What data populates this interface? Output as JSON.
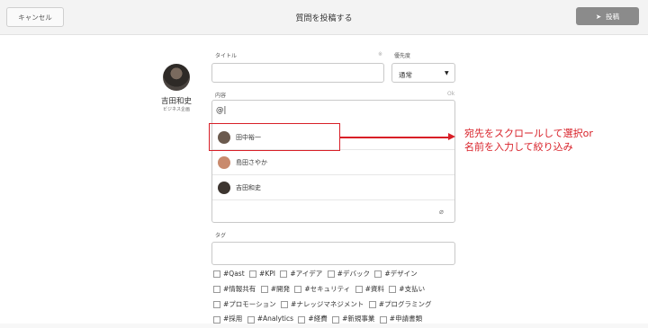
{
  "header": {
    "cancel_label": "キャンセル",
    "title": "質問を投稿する",
    "post_label": "投稿"
  },
  "user": {
    "name": "吉田和史",
    "department": "ビジネス企画"
  },
  "form": {
    "title_label": "タイトル",
    "title_required_mark": "※",
    "priority_label": "優先度",
    "priority_value": "通常",
    "content_label": "内容",
    "content_ok": "Ok",
    "content_value": "@|",
    "tag_label": "タグ"
  },
  "mentions": [
    {
      "name": "田中裕一",
      "avatar_color": "#6b5a4e"
    },
    {
      "name": "島田さやか",
      "avatar_color": "#c98a6d"
    },
    {
      "name": "吉田和史",
      "avatar_color": "#3d3530"
    }
  ],
  "annotation": {
    "line1": "宛先をスクロールして選択or",
    "line2": "名前を入力して絞り込み",
    "color": "#d81f27"
  },
  "tags": [
    [
      "#Qast",
      "#KPI",
      "#アイデア",
      "#デバック",
      "#デザイン"
    ],
    [
      "#情報共有",
      "#開発",
      "#セキュリティ",
      "#資料",
      "#支払い"
    ],
    [
      "#プロモーション",
      "#ナレッジマネジメント",
      "#プログラミング"
    ],
    [
      "#採用",
      "#Analytics",
      "#経費",
      "#新規事業",
      "#申請書類"
    ]
  ]
}
